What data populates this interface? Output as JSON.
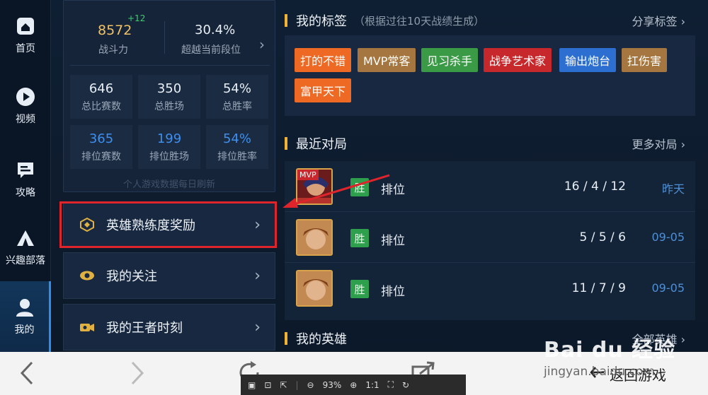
{
  "nav": {
    "items": [
      {
        "label": "首页",
        "icon": "home-icon"
      },
      {
        "label": "视频",
        "icon": "play-icon"
      },
      {
        "label": "攻略",
        "icon": "guide-icon"
      },
      {
        "label": "兴趣部落",
        "icon": "tribe-icon"
      },
      {
        "label": "我的",
        "icon": "profile-icon",
        "active": true
      }
    ]
  },
  "stats": {
    "power_value": "8572",
    "power_delta": "+12",
    "power_label": "战斗力",
    "rank_percent": "30.4%",
    "rank_label": "超越当前段位",
    "cells": [
      {
        "value": "646",
        "label": "总比赛数"
      },
      {
        "value": "350",
        "label": "总胜场"
      },
      {
        "value": "54%",
        "label": "总胜率"
      },
      {
        "value": "365",
        "label": "排位赛数"
      },
      {
        "value": "199",
        "label": "排位胜场"
      },
      {
        "value": "54%",
        "label": "排位胜率"
      }
    ],
    "refresh_note": "个人游戏数据每日刷新"
  },
  "menu": {
    "items": [
      {
        "label": "英雄熟练度奖励",
        "icon": "proficiency-badge-icon"
      },
      {
        "label": "我的关注",
        "icon": "eye-icon"
      },
      {
        "label": "我的王者时刻",
        "icon": "video-camera-icon"
      }
    ]
  },
  "tags_section": {
    "title": "我的标签",
    "subtitle": "（根据过往10天战绩生成）",
    "share": "分享标签",
    "tags": [
      {
        "label": "打的不错",
        "color": "#ee6a24"
      },
      {
        "label": "MVP常客",
        "color": "#a5763f"
      },
      {
        "label": "见习杀手",
        "color": "#3a9a46"
      },
      {
        "label": "战争艺术家",
        "color": "#c7282b"
      },
      {
        "label": "输出炮台",
        "color": "#2c6fd0"
      },
      {
        "label": "扛伤害",
        "color": "#a5763f"
      },
      {
        "label": "富甲天下",
        "color": "#ee6a24"
      }
    ]
  },
  "recent_section": {
    "title": "最近对局",
    "more": "更多对局",
    "matches": [
      {
        "result": "胜",
        "mode": "排位",
        "kda": "16 / 4 / 12",
        "date": "昨天",
        "mvp": "MVP"
      },
      {
        "result": "胜",
        "mode": "排位",
        "kda": "5 / 5 / 6",
        "date": "09-05"
      },
      {
        "result": "胜",
        "mode": "排位",
        "kda": "11 / 7 / 9",
        "date": "09-05"
      }
    ]
  },
  "heroes_section": {
    "title": "我的英雄",
    "more": "全部英雄"
  },
  "toolbar": {
    "zoom": "93%",
    "fit_label": "1:1",
    "back_to_game": "返回游戏"
  },
  "watermark": {
    "brand": "Bai du 经验",
    "url": "jingyan.baidu.com"
  }
}
